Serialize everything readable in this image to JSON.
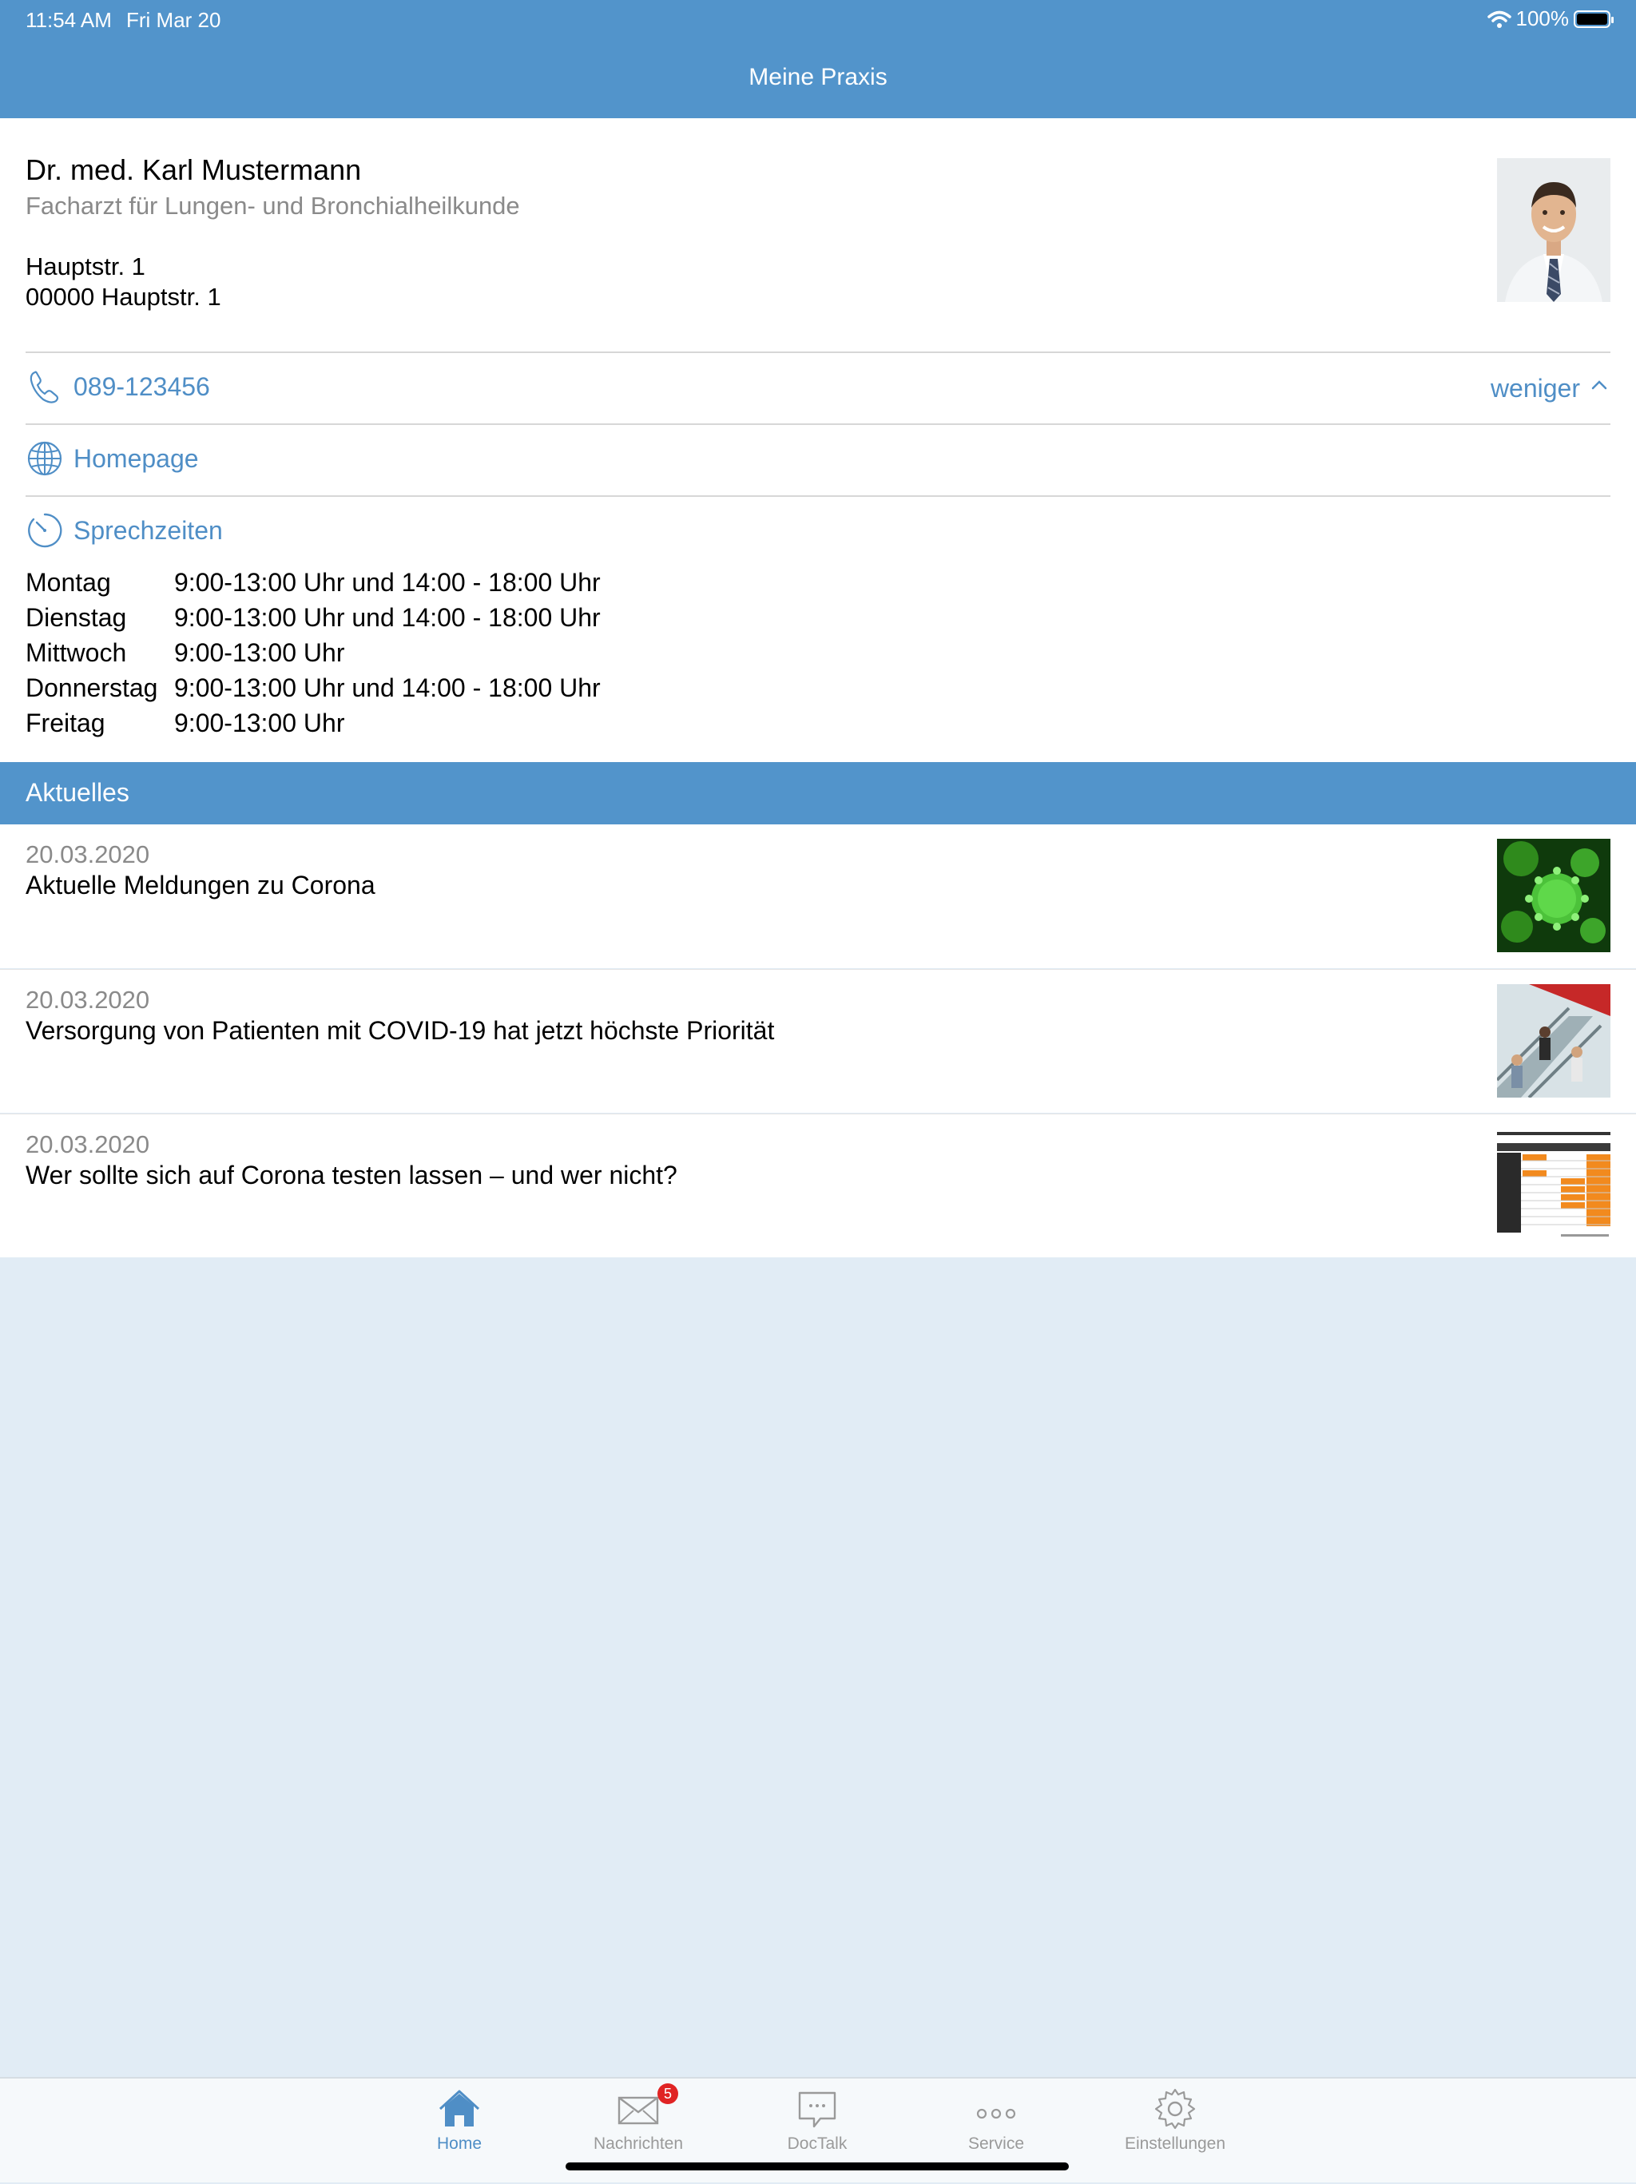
{
  "status_bar": {
    "time": "11:54 AM",
    "date": "Fri Mar 20",
    "battery": "100%"
  },
  "header": {
    "title": "Meine Praxis"
  },
  "practice": {
    "name": "Dr. med. Karl Mustermann",
    "specialty": "Facharzt für Lungen- und Bronchialheilkunde",
    "address_line1": "Hauptstr. 1",
    "address_line2": "00000 Hauptstr. 1",
    "phone": "089-123456",
    "less_label": "weniger",
    "homepage_label": "Homepage",
    "hours_label": "Sprechzeiten",
    "hours": [
      {
        "day": "Montag",
        "time": "9:00-13:00 Uhr und 14:00 - 18:00 Uhr"
      },
      {
        "day": "Dienstag",
        "time": "9:00-13:00 Uhr und 14:00 - 18:00 Uhr"
      },
      {
        "day": "Mittwoch",
        "time": "9:00-13:00 Uhr"
      },
      {
        "day": "Donnerstag",
        "time": "9:00-13:00 Uhr und 14:00 - 18:00 Uhr"
      },
      {
        "day": "Freitag",
        "time": "9:00-13:00 Uhr"
      }
    ]
  },
  "news": {
    "section_title": "Aktuelles",
    "items": [
      {
        "date": "20.03.2020",
        "title": "Aktuelle Meldungen zu Corona",
        "thumb": "virus-image"
      },
      {
        "date": "20.03.2020",
        "title": "Versorgung von Patienten mit COVID-19 hat jetzt höchste Priorität",
        "thumb": "escalator-image"
      },
      {
        "date": "20.03.2020",
        "title": "Wer sollte sich auf Corona testen lassen – und wer nicht?",
        "thumb": "table-image"
      }
    ]
  },
  "tabbar": {
    "tabs": [
      {
        "label": "Home",
        "icon": "home-icon",
        "active": true
      },
      {
        "label": "Nachrichten",
        "icon": "envelope-icon",
        "badge": "5"
      },
      {
        "label": "DocTalk",
        "icon": "chat-icon"
      },
      {
        "label": "Service",
        "icon": "dots-icon"
      },
      {
        "label": "Einstellungen",
        "icon": "gear-icon"
      }
    ]
  },
  "colors": {
    "primary": "#5294cb",
    "link": "#4f8ec6",
    "background": "#e1ecf5",
    "badge": "#e02424"
  }
}
